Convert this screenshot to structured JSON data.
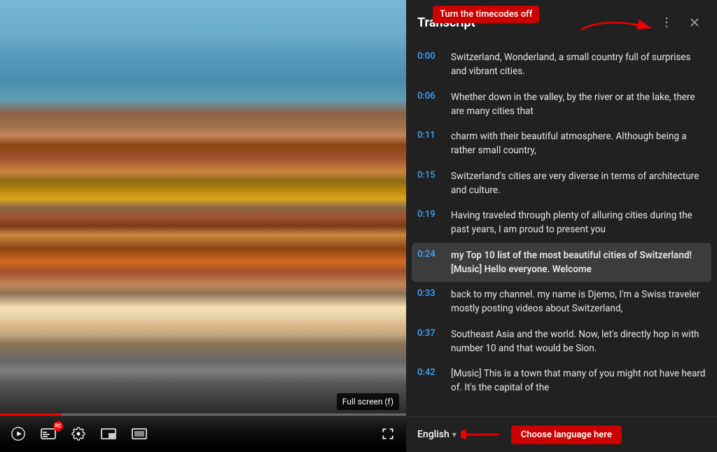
{
  "annotations": {
    "timecode_tooltip": "Turn the timecodes off",
    "choose_language": "Choose language here"
  },
  "video": {
    "fullscreen_tooltip": "Full screen (f)",
    "controls": {
      "play": "play",
      "captions": "captions",
      "settings": "settings",
      "miniplayer": "miniplayer",
      "theater": "theater",
      "fullscreen": "fullscreen"
    }
  },
  "transcript": {
    "title": "Transcript",
    "entries": [
      {
        "timecode": "0:00",
        "text": "Switzerland, Wonderland, a small country  full of surprises and vibrant cities.",
        "active": false
      },
      {
        "timecode": "0:06",
        "text": "Whether down in the valley, by the river  or at the lake, there are many cities that",
        "active": false
      },
      {
        "timecode": "0:11",
        "text": "charm with their beautiful atmosphere.  Although being a rather small country,",
        "active": false
      },
      {
        "timecode": "0:15",
        "text": "Switzerland's cities are very diverse  in terms of architecture and culture.",
        "active": false
      },
      {
        "timecode": "0:19",
        "text": "Having traveled through plenty of alluring cities  during the past years, I am proud to present you",
        "active": false
      },
      {
        "timecode": "0:24",
        "text": "my Top 10 list of the most beautiful cities of Switzerland! [Music] Hello everyone. Welcome",
        "active": true,
        "bold": true
      },
      {
        "timecode": "0:33",
        "text": "back to my channel. my name is Djemo, I'm a Swiss traveler mostly posting videos about Switzerland,",
        "active": false
      },
      {
        "timecode": "0:37",
        "text": "Southeast Asia and the world. Now, let's directly  hop in with number 10 and that would be Sion.",
        "active": false
      },
      {
        "timecode": "0:42",
        "text": "[Music] This is a town that many of you might  not have heard of. It's the capital of the",
        "active": false
      }
    ],
    "language": "English",
    "language_chevron": "▾"
  }
}
